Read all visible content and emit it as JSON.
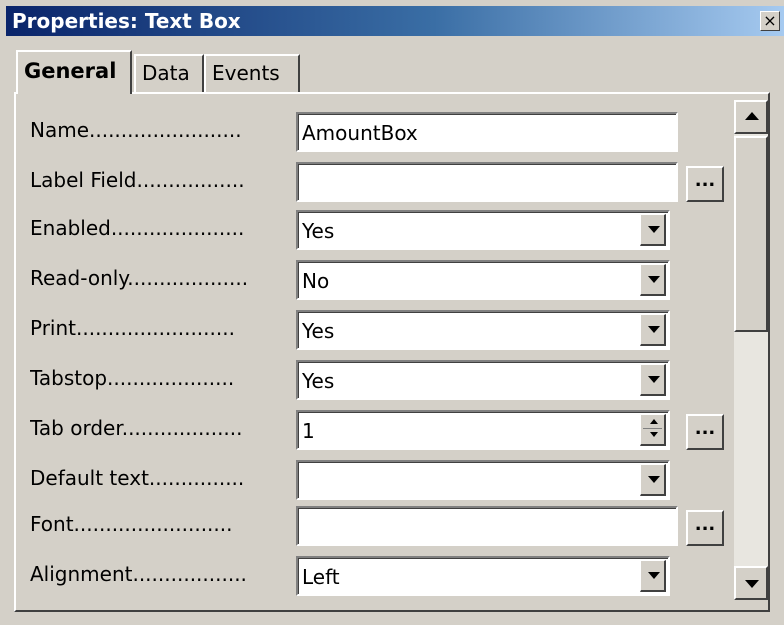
{
  "window": {
    "title": "Properties: Text Box",
    "close_glyph": "×"
  },
  "tabs": [
    {
      "label": "General",
      "active": true
    },
    {
      "label": "Data",
      "active": false
    },
    {
      "label": "Events",
      "active": false
    }
  ],
  "properties": [
    {
      "label": "Name........................",
      "value": "AmountBox",
      "control": "text"
    },
    {
      "label": "Label Field.................",
      "value": "",
      "control": "text-browse"
    },
    {
      "label": "Enabled.....................",
      "value": "Yes",
      "control": "dropdown"
    },
    {
      "label": "Read-only...................",
      "value": "No",
      "control": "dropdown"
    },
    {
      "label": "Print.........................",
      "value": "Yes",
      "control": "dropdown"
    },
    {
      "label": "Tabstop....................",
      "value": "Yes",
      "control": "dropdown"
    },
    {
      "label": "Tab order...................",
      "value": "1",
      "control": "spinner-browse"
    },
    {
      "label": "Default text...............",
      "value": "",
      "control": "dropdown"
    },
    {
      "label": "Font.........................",
      "value": "",
      "control": "text-browse"
    },
    {
      "label": "Alignment..................",
      "value": "Left",
      "control": "dropdown"
    }
  ],
  "browse_label": "...",
  "colors": {
    "titlebar_start": "#0a246a",
    "titlebar_end": "#a6caf0",
    "face": "#d4d0c8"
  }
}
